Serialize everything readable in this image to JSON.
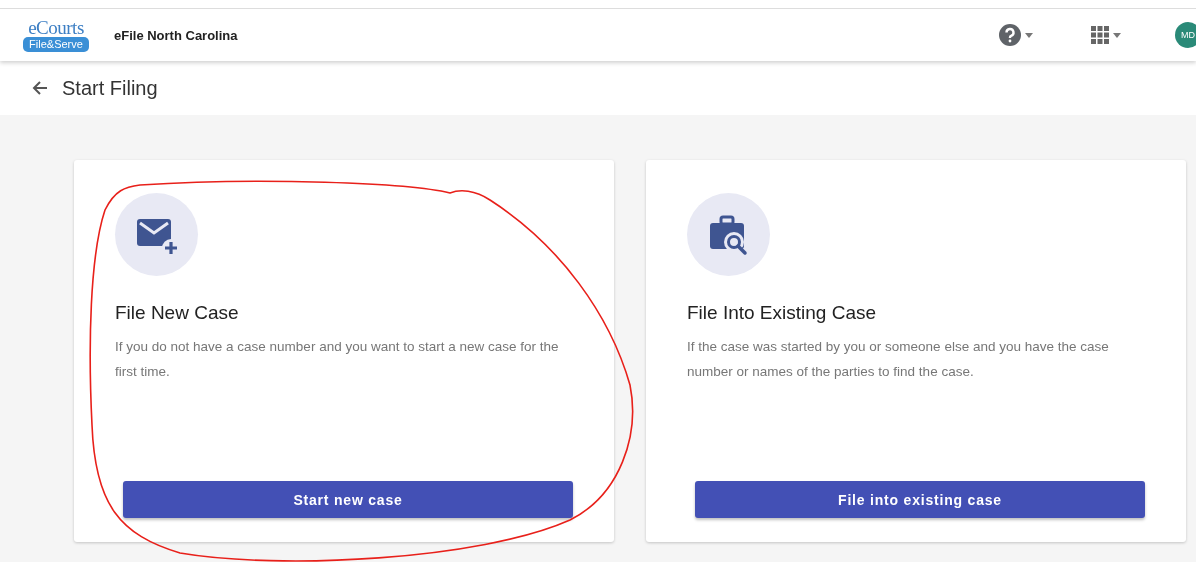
{
  "header": {
    "logo_top": "eCourts",
    "logo_bottom": "File&Serve",
    "title": "eFile North Carolina",
    "avatar": "MD"
  },
  "page": {
    "title": "Start Filing"
  },
  "cards": [
    {
      "kind": "new",
      "title": "File New Case",
      "description": "If you do not have a case number and you want to start a new case for the first time.",
      "button": "Start new case",
      "annotated": true
    },
    {
      "kind": "existing",
      "title": "File Into Existing Case",
      "description": "If the case was started by you or someone else and you have the case number or names of the parties to find the case.",
      "button": "File into existing case",
      "annotated": false
    }
  ]
}
